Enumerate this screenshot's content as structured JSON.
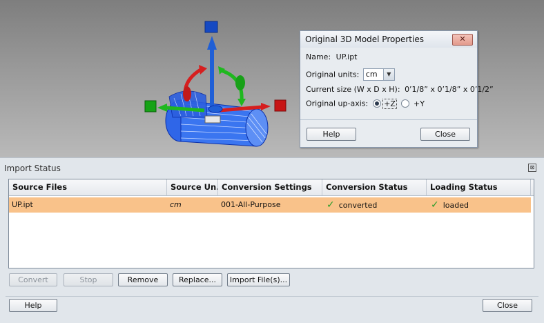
{
  "props_dialog": {
    "title": "Original 3D Model Properties",
    "close_glyph": "✕",
    "name_label": "Name:",
    "name_value": "UP.ipt",
    "units_label": "Original units:",
    "units_value": "cm",
    "size_label": "Current size (W x D x H):",
    "size_value": "0’1/8” x 0’1/8” x 0’1/2”",
    "upaxis_label": "Original up-axis:",
    "upaxis_options": [
      "+Z",
      "+Y"
    ],
    "upaxis_selected": "+Z",
    "help_label": "Help",
    "close_label": "Close"
  },
  "import_status": {
    "title": "Import Status",
    "close_glyph": "⊠",
    "columns": [
      "Source Files",
      "Source Un...",
      "Conversion Settings",
      "Conversion Status",
      "Loading Status"
    ],
    "rows": [
      {
        "source_file": "UP.ipt",
        "source_units": "cm",
        "conversion_settings": "001-All-Purpose",
        "conversion_status": "converted",
        "loading_status": "loaded"
      }
    ],
    "buttons": {
      "convert": "Convert",
      "stop": "Stop",
      "remove": "Remove",
      "replace": "Replace...",
      "import_files": "Import File(s)...",
      "help": "Help",
      "close": "Close"
    }
  },
  "colors": {
    "selected_row": "#f9c28a",
    "check_green": "#2a9d2a",
    "axis_blue": "#1f5fd6",
    "axis_red": "#d61e1e",
    "axis_green": "#1fb81f"
  },
  "icons": [
    "check-icon",
    "gizmo-axis-z-icon",
    "gizmo-axis-x-icon",
    "gizmo-axis-y-icon",
    "dropdown-arrow-icon",
    "close-icon"
  ]
}
